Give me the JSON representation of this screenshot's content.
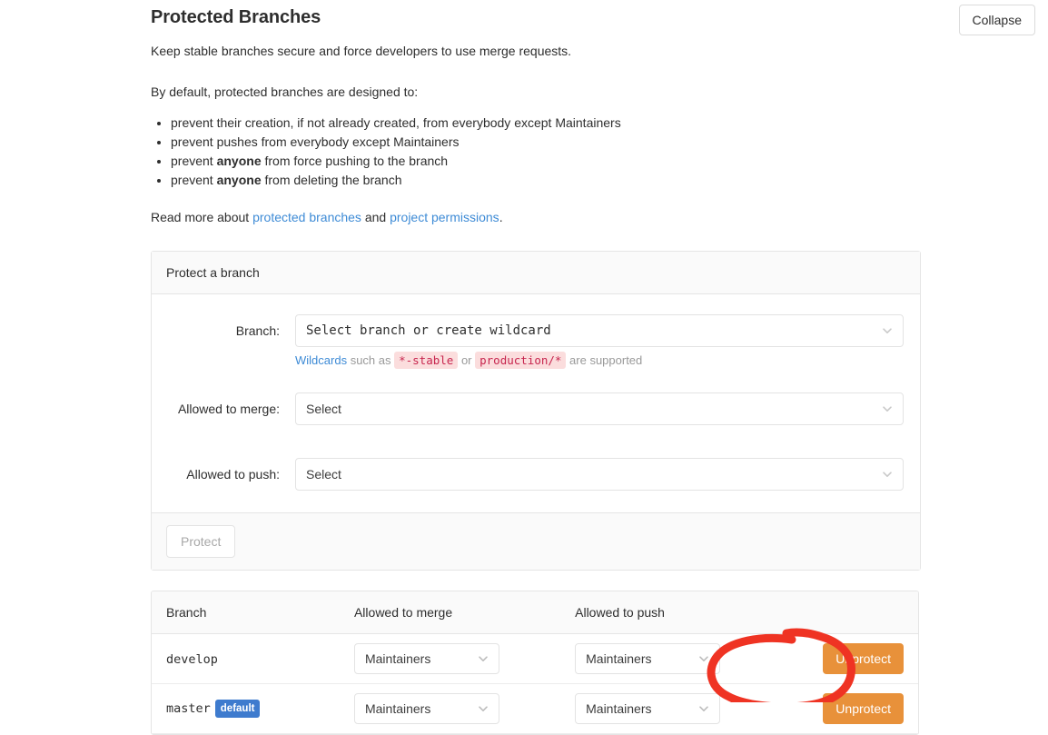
{
  "header": {
    "title": "Protected Branches",
    "collapse_label": "Collapse"
  },
  "intro": {
    "lead": "Keep stable branches secure and force developers to use merge requests.",
    "lead2": "By default, protected branches are designed to:",
    "bullets": [
      {
        "prefix": "prevent their creation, if not already created, from everybody except Maintainers",
        "bold": "",
        "suffix": ""
      },
      {
        "prefix": "prevent pushes from everybody except Maintainers",
        "bold": "",
        "suffix": ""
      },
      {
        "prefix": "prevent ",
        "bold": "anyone",
        "suffix": " from force pushing to the branch"
      },
      {
        "prefix": "prevent ",
        "bold": "anyone",
        "suffix": " from deleting the branch"
      }
    ],
    "readmore_prefix": "Read more about ",
    "readmore_link1": "protected branches",
    "readmore_mid": " and ",
    "readmore_link2": "project permissions",
    "readmore_suffix": "."
  },
  "protect_panel": {
    "heading": "Protect a branch",
    "branch_label": "Branch:",
    "branch_value": "Select branch or create wildcard",
    "help_link": "Wildcards",
    "help_text1": " such as ",
    "help_code1": "*-stable",
    "help_text2": " or ",
    "help_code2": "production/*",
    "help_text3": " are supported",
    "merge_label": "Allowed to merge:",
    "merge_value": "Select",
    "push_label": "Allowed to push:",
    "push_value": "Select",
    "protect_button": "Protect"
  },
  "table": {
    "columns": [
      "Branch",
      "Allowed to merge",
      "Allowed to push",
      ""
    ],
    "rows": [
      {
        "branch": "develop",
        "badge": "",
        "merge": "Maintainers",
        "push": "Maintainers",
        "action": "Unprotect"
      },
      {
        "branch": "master",
        "badge": "default",
        "merge": "Maintainers",
        "push": "Maintainers",
        "action": "Unprotect"
      }
    ]
  },
  "colors": {
    "unprotect_orange": "#e8913a",
    "default_badge_blue": "#3e7bce",
    "link_blue": "#3e8bd6",
    "code_red": "#c7254e",
    "annotation_red": "#ef3323"
  }
}
